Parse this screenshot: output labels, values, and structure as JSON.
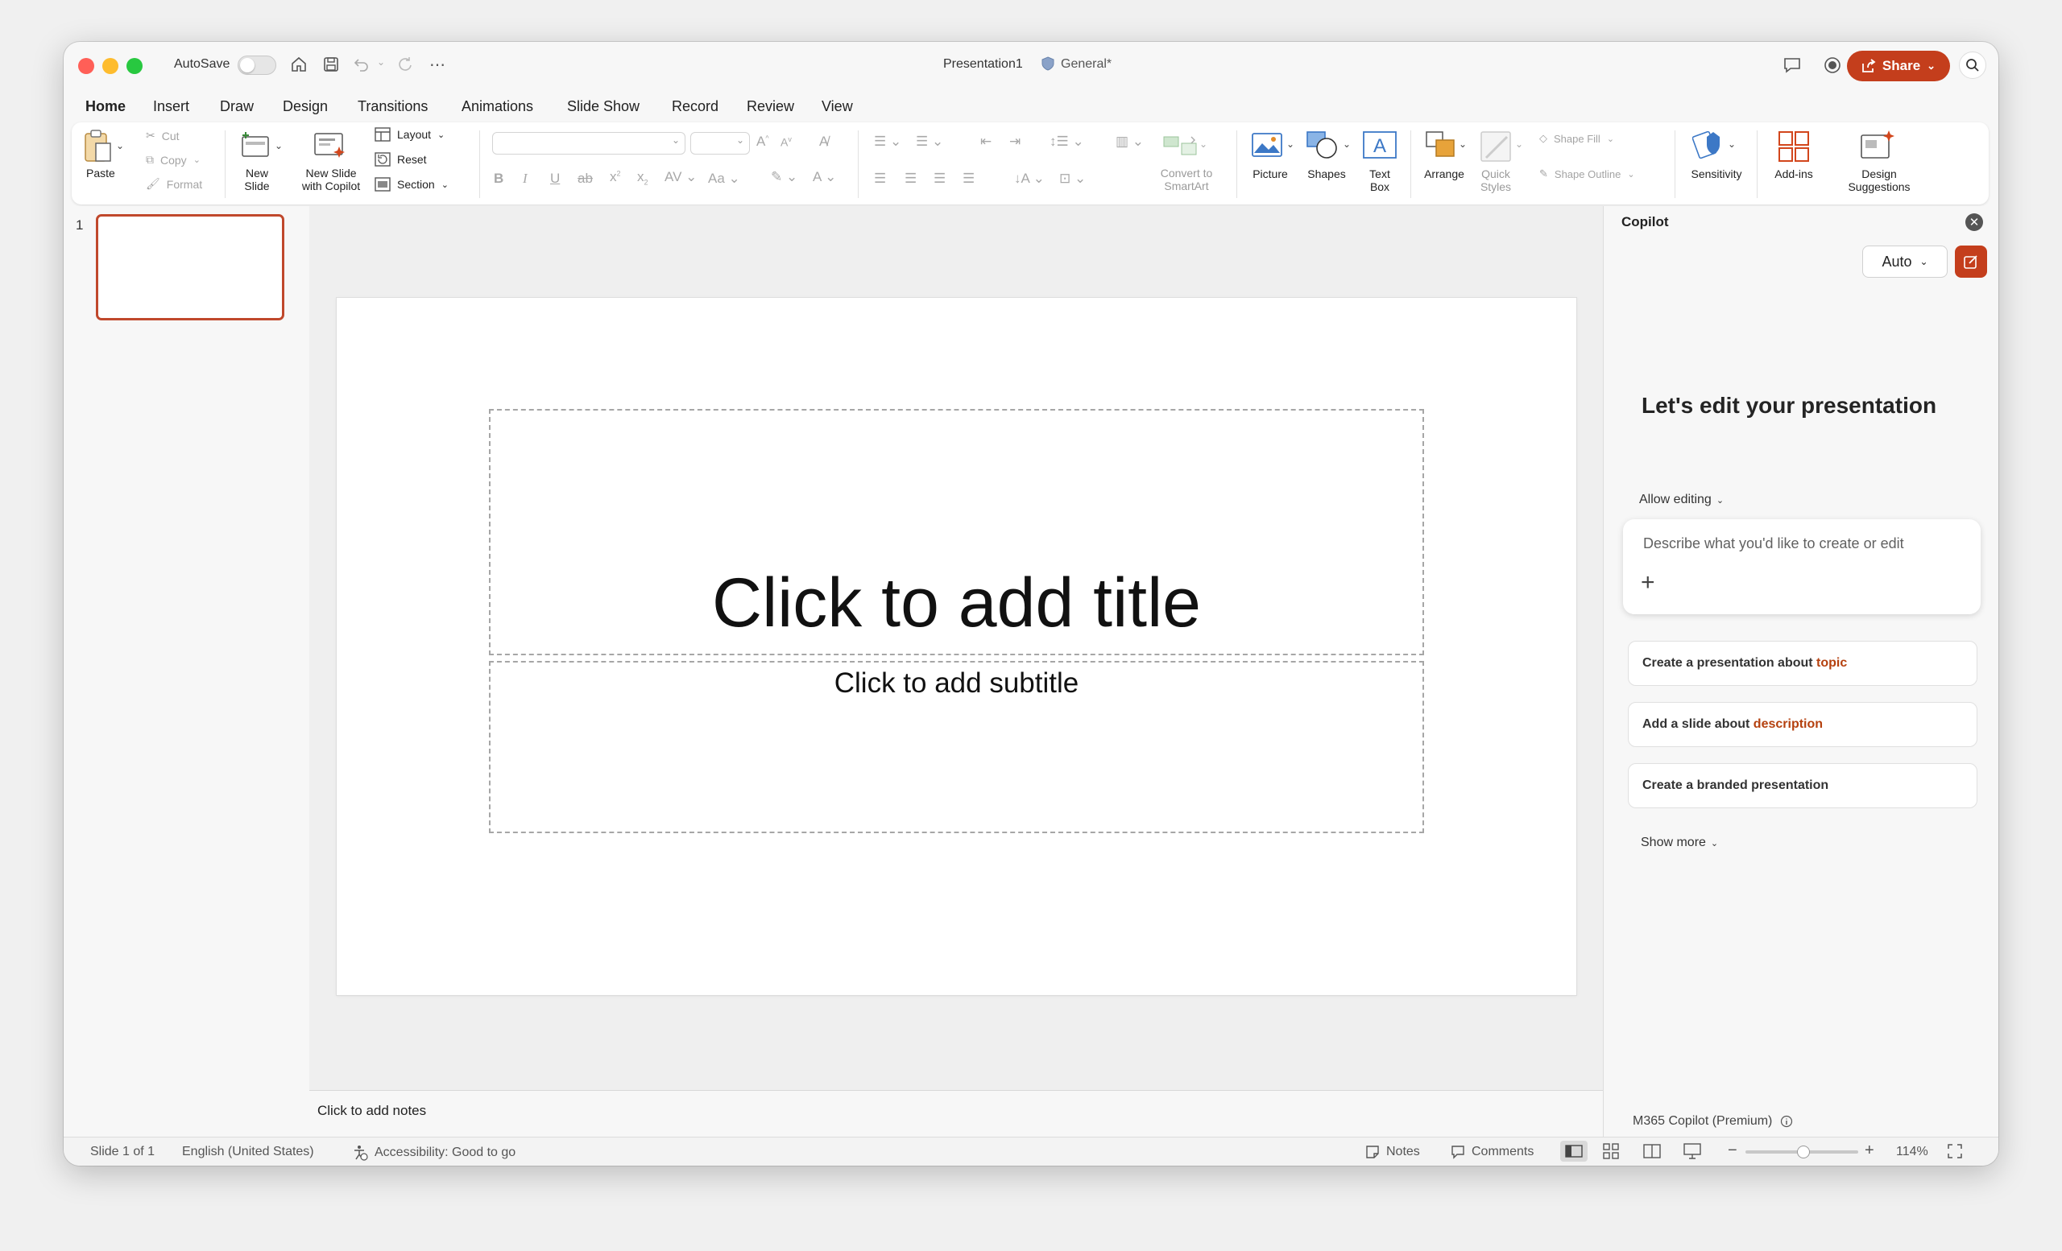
{
  "titlebar": {
    "autosave_label": "AutoSave",
    "document_title": "Presentation1",
    "sensitivity_label": "General*",
    "share_label": "Share",
    "colors": {
      "close": "#ff5f57",
      "minimize": "#febc2e",
      "zoom": "#28c840",
      "accent": "#c43e1c"
    }
  },
  "tabs": [
    "Home",
    "Insert",
    "Draw",
    "Design",
    "Transitions",
    "Animations",
    "Slide Show",
    "Record",
    "Review",
    "View"
  ],
  "active_tab": "Home",
  "ribbon": {
    "paste": "Paste",
    "cut": "Cut",
    "copy": "Copy",
    "format": "Format",
    "new_slide": [
      "New",
      "Slide"
    ],
    "new_slide_copilot": [
      "New Slide",
      "with Copilot"
    ],
    "layout": "Layout",
    "reset": "Reset",
    "section": "Section",
    "convert_smartart": [
      "Convert to",
      "SmartArt"
    ],
    "picture": "Picture",
    "shapes": "Shapes",
    "text_box": [
      "Text",
      "Box"
    ],
    "arrange": "Arrange",
    "quick_styles": [
      "Quick",
      "Styles"
    ],
    "shape_fill": "Shape Fill",
    "shape_outline": "Shape Outline",
    "sensitivity": "Sensitivity",
    "add_ins": "Add-ins",
    "design_suggestions": [
      "Design",
      "Suggestions"
    ]
  },
  "thumbnails": {
    "slide_number": "1"
  },
  "slide": {
    "title_placeholder": "Click to add title",
    "subtitle_placeholder": "Click to add subtitle"
  },
  "notes": {
    "placeholder": "Click to add notes"
  },
  "copilot": {
    "title": "Copilot",
    "mode": "Auto",
    "heading": "Let's edit your presentation",
    "allow_editing": "Allow editing",
    "input_placeholder": "Describe what you'd like to create or edit",
    "suggestions": [
      {
        "text": "Create a presentation about ",
        "highlight": "topic"
      },
      {
        "text": "Add a slide about ",
        "highlight": "description"
      },
      {
        "text": "Create a branded presentation",
        "highlight": ""
      }
    ],
    "show_more": "Show more",
    "footer": "M365 Copilot (Premium)"
  },
  "status": {
    "slide_indicator": "Slide 1 of 1",
    "language": "English (United States)",
    "accessibility": "Accessibility: Good to go",
    "notes": "Notes",
    "comments": "Comments",
    "zoom": "114%"
  }
}
